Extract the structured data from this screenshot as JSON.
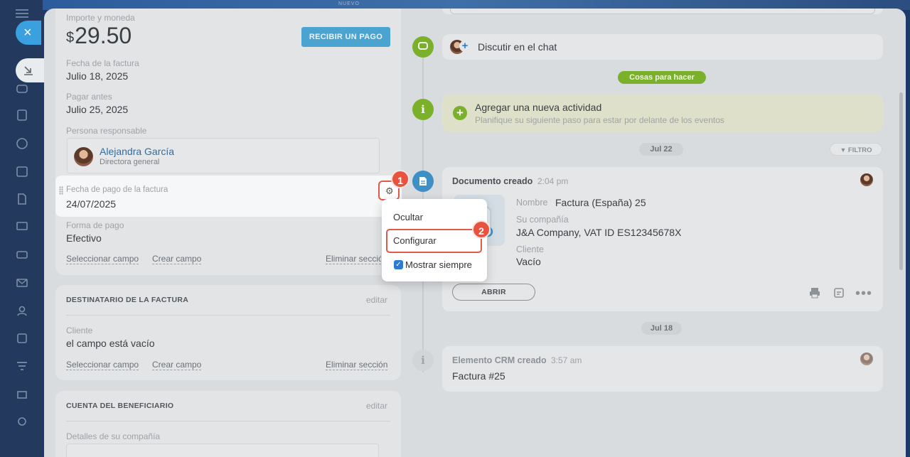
{
  "top_badge": "NUEVO",
  "close_label": "×",
  "left": {
    "amount_label": "Importe y moneda",
    "currency": "$",
    "amount": "29.50",
    "receive_payment": "RECIBIR UN PAGO",
    "invoice_date_label": "Fecha de la factura",
    "invoice_date": "Julio 18, 2025",
    "pay_before_label": "Pagar antes",
    "pay_before": "Julio 25, 2025",
    "responsible_label": "Persona responsable",
    "responsible_name": "Alejandra García",
    "responsible_title": "Directora general",
    "payment_date_label": "Fecha de pago de la factura",
    "payment_date": "24/07/2025",
    "payment_method_label": "Forma de pago",
    "payment_method": "Efectivo",
    "select_field": "Seleccionar campo",
    "create_field": "Crear campo",
    "delete_section": "Eliminar sección",
    "recipient_title": "DESTINATARIO DE LA FACTURA",
    "edit": "editar",
    "client_label": "Cliente",
    "client_empty": "el campo está vacío",
    "beneficiary_title": "CUENTA DEL BENEFICIARIO",
    "company_details_label": "Detalles de su compañía"
  },
  "menu": {
    "hide": "Ocultar",
    "configure": "Configurar",
    "always_show": "Mostrar siempre"
  },
  "badges": {
    "one": "1",
    "two": "2"
  },
  "right": {
    "discuss_chat": "Discutir en el chat",
    "todo_pill": "Cosas para hacer",
    "add_activity_title": "Agregar una nueva actividad",
    "add_activity_sub": "Planifique su siguiente paso para estar por delante de los eventos",
    "date_jul22": "Jul 22",
    "filter": "FILTRO",
    "doc_created": "Documento creado",
    "doc_time": "2:04 pm",
    "name_label": "Nombre",
    "name_value": "Factura (España) 25",
    "company_label": "Su compañía",
    "company_value": "J&A Company, VAT ID ES12345678X",
    "client_label": "Cliente",
    "client_value": "Vacío",
    "open_btn": "ABRIR",
    "date_jul18": "Jul 18",
    "crm_created": "Elemento CRM creado",
    "crm_time": "3:57 am",
    "invoice_ref": "Factura #25"
  },
  "colors": {
    "accent_blue": "#4aa4cf",
    "green": "#7ab02a",
    "highlight_red": "#e05a4a",
    "link_blue": "#2f6ea5"
  }
}
